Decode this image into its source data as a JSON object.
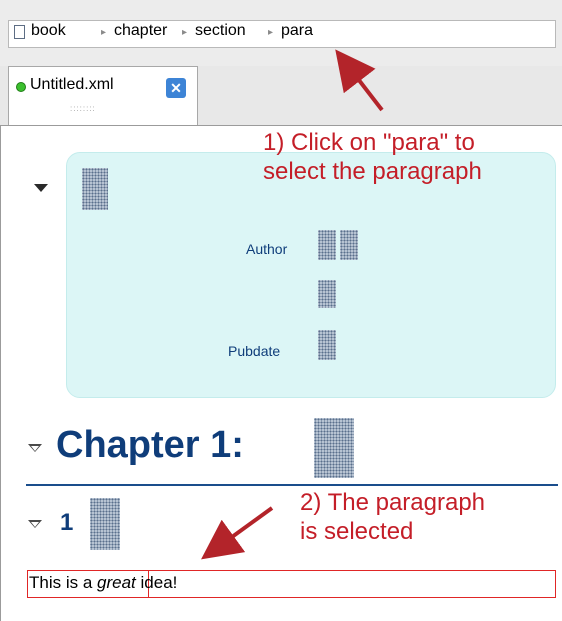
{
  "breadcrumb": {
    "items": [
      "book",
      "chapter",
      "section",
      "para"
    ],
    "separator": "▸"
  },
  "tab": {
    "label": "Untitled.xml",
    "close_glyph": "✕",
    "grip": "::::::::"
  },
  "document": {
    "info": {
      "author_label": "Author",
      "pubdate_label": "Pubdate"
    },
    "chapter_title": "Chapter 1:",
    "section_number": "1",
    "paragraph": {
      "before": "This is a ",
      "emphasis": "great",
      "after": " idea!"
    }
  },
  "annotations": {
    "note1_line1": "1) Click on \"para\" to",
    "note1_line2": "select the paragraph",
    "note2_line1": "2) The paragraph",
    "note2_line2": "is selected",
    "color": "#c41e28"
  },
  "colors": {
    "accent": "#0f3d7a",
    "info_box_bg": "#dcf6f6",
    "selection_border": "#e02626",
    "tab_status": "#3bbf2e"
  },
  "icons": {
    "document": "document-icon",
    "collapse": "collapse-triangle-icon",
    "close": "close-icon"
  }
}
